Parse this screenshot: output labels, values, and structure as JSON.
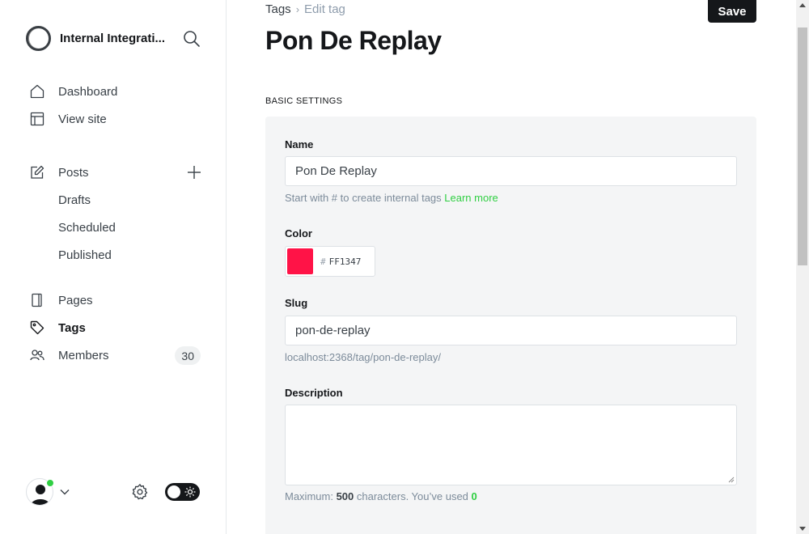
{
  "sidebar": {
    "site_name": "Internal Integrati...",
    "nav_top": [
      {
        "label": "Dashboard"
      },
      {
        "label": "View site"
      }
    ],
    "posts": {
      "label": "Posts",
      "subitems": [
        {
          "label": "Drafts"
        },
        {
          "label": "Scheduled"
        },
        {
          "label": "Published"
        }
      ]
    },
    "nav_bottom": [
      {
        "label": "Pages"
      },
      {
        "label": "Tags"
      },
      {
        "label": "Members",
        "badge": "30"
      }
    ]
  },
  "header": {
    "breadcrumb_parent": "Tags",
    "breadcrumb_current": "Edit tag",
    "save_label": "Save",
    "title": "Pon De Replay"
  },
  "form": {
    "section_label": "BASIC SETTINGS",
    "name_label": "Name",
    "name_value": "Pon De Replay",
    "name_hint": "Start with # to create internal tags ",
    "name_hint_link": "Learn more",
    "color_label": "Color",
    "color_hash": "#",
    "color_value": "FF1347",
    "color_hex": "#FF1347",
    "slug_label": "Slug",
    "slug_value": "pon-de-replay",
    "slug_url": "localhost:2368/tag/pon-de-replay/",
    "description_label": "Description",
    "description_value": "",
    "desc_hint_prefix": "Maximum: ",
    "desc_hint_max": "500",
    "desc_hint_middle": " characters. You’ve used ",
    "desc_hint_used": "0"
  },
  "colors": {
    "accent_green": "#30cf43",
    "dark": "#15171a",
    "tag_color": "#FF1347"
  }
}
